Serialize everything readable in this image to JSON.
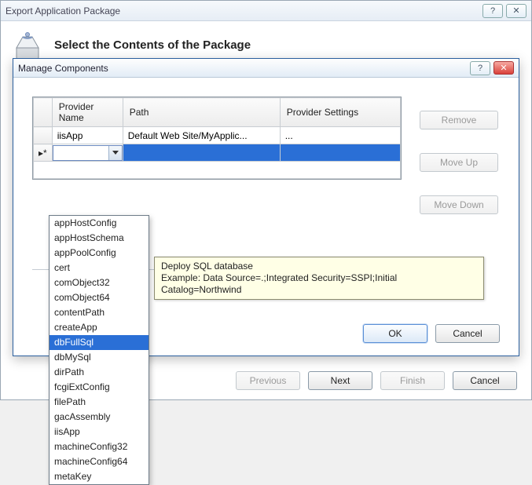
{
  "outer": {
    "title": "Export Application Package",
    "heading": "Select the Contents of the Package",
    "buttons": {
      "previous": "Previous",
      "next": "Next",
      "finish": "Finish",
      "cancel": "Cancel"
    }
  },
  "inner": {
    "title": "Manage Components",
    "grid": {
      "headers": {
        "provider": "Provider Name",
        "path": "Path",
        "settings": "Provider Settings"
      },
      "rows": [
        {
          "provider": "iisApp",
          "path": "Default Web Site/MyApplic...",
          "settings": "..."
        }
      ],
      "new_row_marker": "▸*"
    },
    "side": {
      "remove": "Remove",
      "moveup": "Move Up",
      "movedown": "Move Down"
    },
    "footer": {
      "ok": "OK",
      "cancel": "Cancel"
    }
  },
  "dropdown": {
    "items": [
      "appHostConfig",
      "appHostSchema",
      "appPoolConfig",
      "cert",
      "comObject32",
      "comObject64",
      "contentPath",
      "createApp",
      "dbFullSql",
      "dbMySql",
      "dirPath",
      "fcgiExtConfig",
      "filePath",
      "gacAssembly",
      "iisApp",
      "machineConfig32",
      "machineConfig64",
      "metaKey"
    ],
    "selected_index": 8
  },
  "tooltip": {
    "line1": "Deploy SQL database",
    "line2": "Example: Data Source=.;Integrated Security=SSPI;Initial Catalog=Northwind"
  }
}
